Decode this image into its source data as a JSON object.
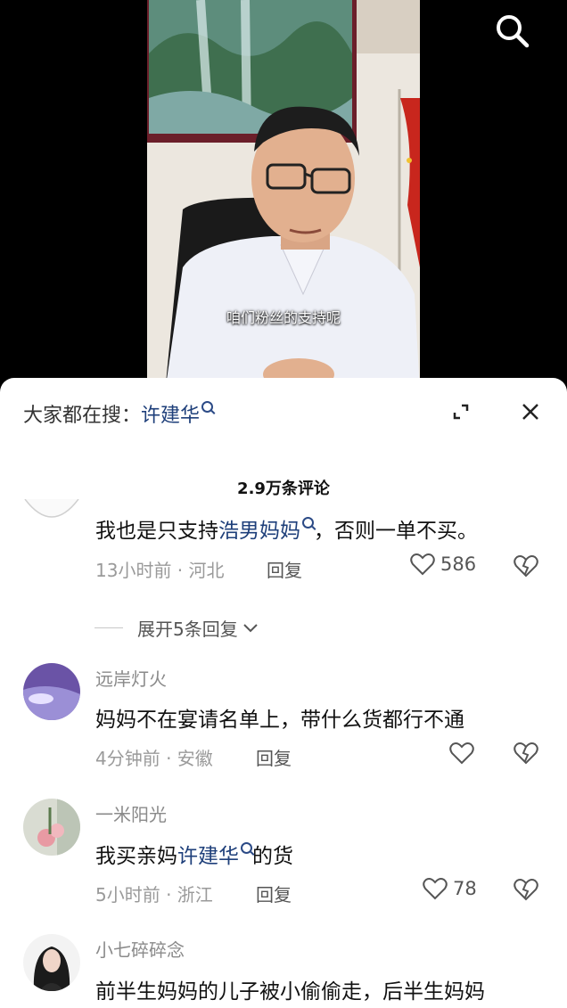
{
  "video": {
    "subtitle": "咱们粉丝的支持呢"
  },
  "sheet": {
    "search_prefix": "大家都在搜：",
    "search_keyword": "许建华",
    "comment_count": "2.9万条评论"
  },
  "comments": [
    {
      "text_before": "我也是只支持",
      "link": "浩男妈妈",
      "text_after": "，否则一单不买。",
      "meta": "13小时前 · 河北",
      "reply": "回复",
      "likes": "586",
      "expand": "展开5条回复"
    },
    {
      "name": "远岸灯火",
      "text": "妈妈不在宴请名单上，带什么货都行不通",
      "meta": "4分钟前 · 安徽",
      "reply": "回复"
    },
    {
      "name": "一米阳光",
      "text_before": "我买亲妈",
      "link": "许建华",
      "text_after": "的货",
      "meta": "5小时前 · 浙江",
      "reply": "回复",
      "likes": "78"
    },
    {
      "name": "小七碎碎念",
      "text": "前半生妈妈的儿子被小偷偷走，后半生妈妈"
    }
  ],
  "colors": {
    "link": "#1e3f7a",
    "flag_red": "#c8261d"
  }
}
